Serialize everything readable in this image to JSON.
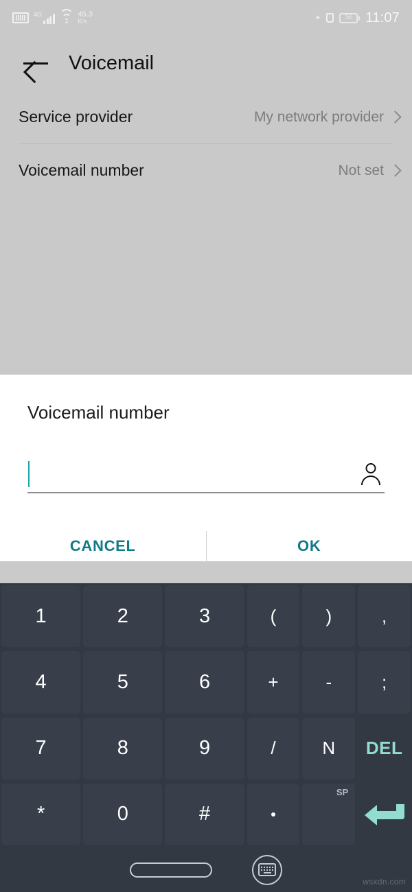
{
  "status_bar": {
    "sim_icon": "sim-card-icon",
    "network_type": "4G",
    "signal_icon": "signal-bars-icon",
    "wifi_icon": "wifi-icon",
    "data_rate_value": "45.3",
    "data_rate_unit": "K/s",
    "bluetooth_icon": "bluetooth-icon",
    "alarm_icon": "alarm-icon",
    "battery_level": "56",
    "time": "11:07"
  },
  "app_bar": {
    "back_icon": "back-arrow-icon",
    "title": "Voicemail"
  },
  "settings_rows": [
    {
      "label": "Service provider",
      "value": "My network provider"
    },
    {
      "label": "Voicemail number",
      "value": "Not set"
    }
  ],
  "dialog": {
    "title": "Voicemail number",
    "input_value": "",
    "input_placeholder": "",
    "contact_icon": "person-icon",
    "cancel_label": "CANCEL",
    "ok_label": "OK"
  },
  "keyboard": {
    "rows": [
      [
        {
          "label": "1",
          "type": "wide"
        },
        {
          "label": "2",
          "type": "wide"
        },
        {
          "label": "3",
          "type": "wide"
        },
        {
          "label": "(",
          "type": "narrow"
        },
        {
          "label": ")",
          "type": "narrow"
        },
        {
          "label": ",",
          "type": "narrow"
        }
      ],
      [
        {
          "label": "4",
          "type": "wide"
        },
        {
          "label": "5",
          "type": "wide"
        },
        {
          "label": "6",
          "type": "wide"
        },
        {
          "label": "+",
          "type": "narrow"
        },
        {
          "label": "-",
          "type": "narrow"
        },
        {
          "label": ";",
          "type": "narrow"
        }
      ],
      [
        {
          "label": "7",
          "type": "wide"
        },
        {
          "label": "8",
          "type": "wide"
        },
        {
          "label": "9",
          "type": "wide"
        },
        {
          "label": "/",
          "type": "narrow"
        },
        {
          "label": "N",
          "type": "narrow"
        },
        {
          "label": "DEL",
          "type": "narrow"
        }
      ],
      [
        {
          "label": "*",
          "type": "wide"
        },
        {
          "label": "0",
          "type": "wide"
        },
        {
          "label": "#",
          "type": "wide"
        },
        {
          "label": ".",
          "type": "narrow"
        },
        {
          "label": "",
          "type": "narrow",
          "sup": "SP"
        },
        {
          "label": "",
          "type": "narrow"
        }
      ]
    ],
    "delete_key_label": "DEL",
    "space_key_label": "SP",
    "enter_icon": "enter-return-icon"
  },
  "nav_bar": {
    "home_indicator": "home-pill-indicator",
    "hide_keyboard_icon": "keyboard-hide-icon"
  },
  "watermark": "wsxdn.com",
  "colors": {
    "accent_teal": "#0f7b86",
    "key_teal": "#92ddcf",
    "cursor_teal": "#1ba8a8",
    "page_bg": "#c9c9c9",
    "keyboard_bg": "#333943",
    "key_bg": "#383f4a",
    "dialog_bg": "#ffffff"
  }
}
